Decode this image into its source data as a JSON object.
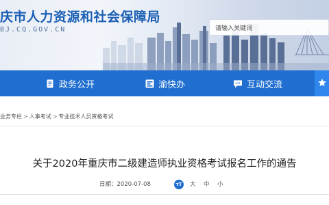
{
  "header": {
    "site_title": "庆市人力资源和社会保障局",
    "site_domain": "BJ.CQ.GOV.CN",
    "search_placeholder": "请输入关键词"
  },
  "nav": {
    "items": [
      {
        "label": "政务公开",
        "icon": "document-icon"
      },
      {
        "label": "渝快办",
        "icon": "app-window-icon"
      },
      {
        "label": "互动交流",
        "icon": "chat-bubble-icon"
      }
    ],
    "side_tab_icon": "star-icon"
  },
  "breadcrumb": {
    "items": [
      "业务专栏",
      "人事考试",
      "专业技术人员资格考试"
    ],
    "separator": ">"
  },
  "article": {
    "title": "关于2020年重庆市二级建造师执业资格考试报名工作的通告",
    "date_label": "日期：",
    "date": "2020-07-08",
    "font_badge": "ᴛT",
    "font_sizes": [
      "大",
      "中",
      "小"
    ]
  },
  "colors": {
    "brand_blue": "#1f6ed0",
    "title_blue": "#1a5fb4",
    "side_tab": "#2f87ee"
  }
}
